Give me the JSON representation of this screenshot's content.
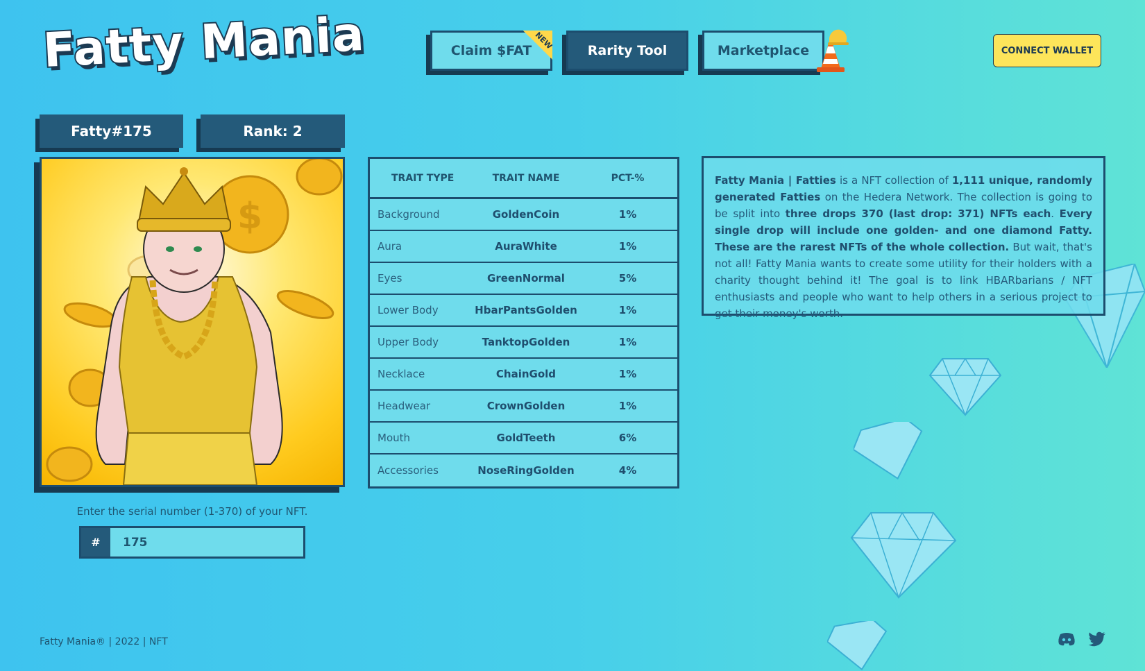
{
  "brand": {
    "logo_text": "Fatty Mania"
  },
  "nav": {
    "items": [
      {
        "label": "Claim $FAT",
        "badge": "NEW"
      },
      {
        "label": "Rarity Tool"
      },
      {
        "label": "Marketplace"
      }
    ],
    "active": "Rarity Tool"
  },
  "connect_label": "CONNECT WALLET",
  "nft": {
    "name": "Fatty#175",
    "rank": "Rank: 2",
    "image_description": "Golden Fatty with crown, gold chain and gold tank top on golden coin background"
  },
  "search": {
    "hint": "Enter the serial number (1-370) of your NFT.",
    "prefix": "#",
    "value": "175"
  },
  "traits": {
    "headers": [
      "TRAIT TYPE",
      "TRAIT NAME",
      "PCT-%"
    ],
    "rows": [
      {
        "type": "Background",
        "name": "GoldenCoin",
        "pct": "1%"
      },
      {
        "type": "Aura",
        "name": "AuraWhite",
        "pct": "1%"
      },
      {
        "type": "Eyes",
        "name": "GreenNormal",
        "pct": "5%"
      },
      {
        "type": "Lower Body",
        "name": "HbarPantsGolden",
        "pct": "1%"
      },
      {
        "type": "Upper Body",
        "name": "TanktopGolden",
        "pct": "1%"
      },
      {
        "type": "Necklace",
        "name": "ChainGold",
        "pct": "1%"
      },
      {
        "type": "Headwear",
        "name": "CrownGolden",
        "pct": "1%"
      },
      {
        "type": "Mouth",
        "name": "GoldTeeth",
        "pct": "6%"
      },
      {
        "type": "Accessories",
        "name": "NoseRingGolden",
        "pct": "4%"
      }
    ]
  },
  "about": {
    "p1_bold": "Fatty Mania | Fatties",
    "p2": " is a NFT collection of ",
    "p3_bold": "1,111 unique, randomly generated Fatties",
    "p4": " on the Hedera Network. The collection is going to be split into ",
    "p5_bold": "three drops 370 (last drop: 371) NFTs each",
    "p6": ". ",
    "p7_bold": "Every single drop will include one golden- and one diamond Fatty. These are the rarest NFTs of the whole collection.",
    "p8": " But wait, that's not all! Fatty Mania wants to create some utility for their holders with a charity thought behind it! The goal is to link HBARbarians / NFT enthusiasts and people who want to help others in a serious project to get their money's worth."
  },
  "footer": {
    "text": "Fatty Mania® | 2022 | NFT"
  },
  "social": [
    "discord-icon",
    "twitter-icon"
  ],
  "colors": {
    "navy": "#245a7a",
    "cyan": "#6fdcec",
    "yellow": "#fde55a",
    "dark": "#1c3a52"
  }
}
